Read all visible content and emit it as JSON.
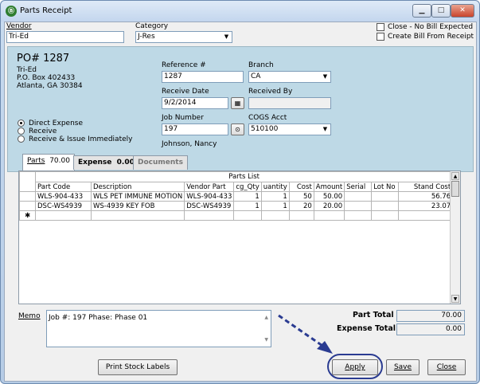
{
  "window": {
    "title": "Parts Receipt"
  },
  "vendor": {
    "label": "Vendor",
    "value": "Tri-Ed"
  },
  "category": {
    "label": "Category",
    "value": "J-Res"
  },
  "options": {
    "close_no_bill": "Close - No Bill Expected",
    "create_bill": "Create Bill From Receipt"
  },
  "po": {
    "number": "PO# 1287",
    "address": [
      "Tri-Ed",
      "P.O. Box 402433",
      "Atlanta, GA  30384"
    ]
  },
  "receive_options": {
    "direct_expense": "Direct Expense",
    "receive": "Receive",
    "receive_issue": "Receive & Issue Immediately",
    "selected": "Direct Expense"
  },
  "reference": {
    "label": "Reference #",
    "value": "1287"
  },
  "branch": {
    "label": "Branch",
    "value": "CA"
  },
  "receive_date": {
    "label": "Receive Date",
    "value": "9/2/2014"
  },
  "received_by": {
    "label": "Received By",
    "value": ""
  },
  "job_number": {
    "label": "Job Number",
    "value": "197",
    "name": "Johnson, Nancy"
  },
  "cogs_acct": {
    "label": "COGS Acct",
    "value": "510100"
  },
  "tabs": [
    {
      "label": "Parts",
      "amount": "70.00"
    },
    {
      "label": "Expense",
      "amount": "0.00"
    },
    {
      "label": "Documents",
      "amount": ""
    }
  ],
  "parts_list": {
    "title": "Parts List",
    "columns": [
      "Part Code",
      "Description",
      "Vendor Part",
      "cg_Qty",
      "uantity",
      "Cost",
      "Amount",
      "Serial",
      "Lot No",
      "Stand Cost"
    ],
    "rows": [
      [
        "WLS-904-433",
        "WLS PET IMMUNE MOTION",
        "WLS-904-433",
        "1",
        "1",
        "50",
        "50.00",
        "",
        "",
        "56.76"
      ],
      [
        "DSC-WS4939",
        "WS-4939 KEY FOB",
        "DSC-WS4939",
        "1",
        "1",
        "20",
        "20.00",
        "",
        "",
        "23.07"
      ]
    ]
  },
  "memo": {
    "label": "Memo",
    "value": "Job #: 197  Phase: Phase 01"
  },
  "totals": {
    "part_label": "Part Total",
    "part_value": "70.00",
    "expense_label": "Expense Total",
    "expense_value": "0.00"
  },
  "buttons": {
    "print_labels": "Print Stock Labels",
    "apply": "Apply",
    "save": "Save",
    "close": "Close"
  },
  "colors": {
    "header_panel": "#bed9e6",
    "annotation": "#2a3b91"
  }
}
